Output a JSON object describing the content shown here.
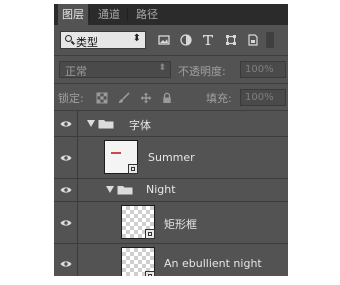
{
  "tabs": [
    {
      "label": "图层",
      "active": true
    },
    {
      "label": "通道",
      "active": false
    },
    {
      "label": "路径",
      "active": false
    }
  ],
  "filter": {
    "kind_label": "类型",
    "icons": [
      "image-filter-icon",
      "adjustment-filter-icon",
      "type-filter-icon",
      "shape-filter-icon",
      "smart-object-filter-icon"
    ]
  },
  "blend": {
    "mode": "正常",
    "opacity_label": "不透明度:",
    "opacity_value": "100%"
  },
  "lock": {
    "label": "锁定:",
    "icons": [
      "lock-transparent-icon",
      "lock-brush-icon",
      "lock-move-icon",
      "lock-all-icon"
    ],
    "fill_label": "填充:",
    "fill_value": "100%"
  },
  "layers": [
    {
      "type": "group",
      "name": "字体",
      "indent": 0,
      "expanded": true
    },
    {
      "type": "layer",
      "name": "Summer",
      "indent": 0,
      "thumb": "plain"
    },
    {
      "type": "group",
      "name": "Night",
      "indent": 1,
      "expanded": true
    },
    {
      "type": "layer",
      "name": "矩形框",
      "indent": 1,
      "thumb": "checker"
    },
    {
      "type": "layer",
      "name": "An ebullient night",
      "indent": 1,
      "thumb": "checker"
    }
  ],
  "colors": {
    "panel": "#535353",
    "tabbar": "#2b2b2b",
    "text": "#e6e6e6",
    "dim_text": "#a0a0a0"
  }
}
